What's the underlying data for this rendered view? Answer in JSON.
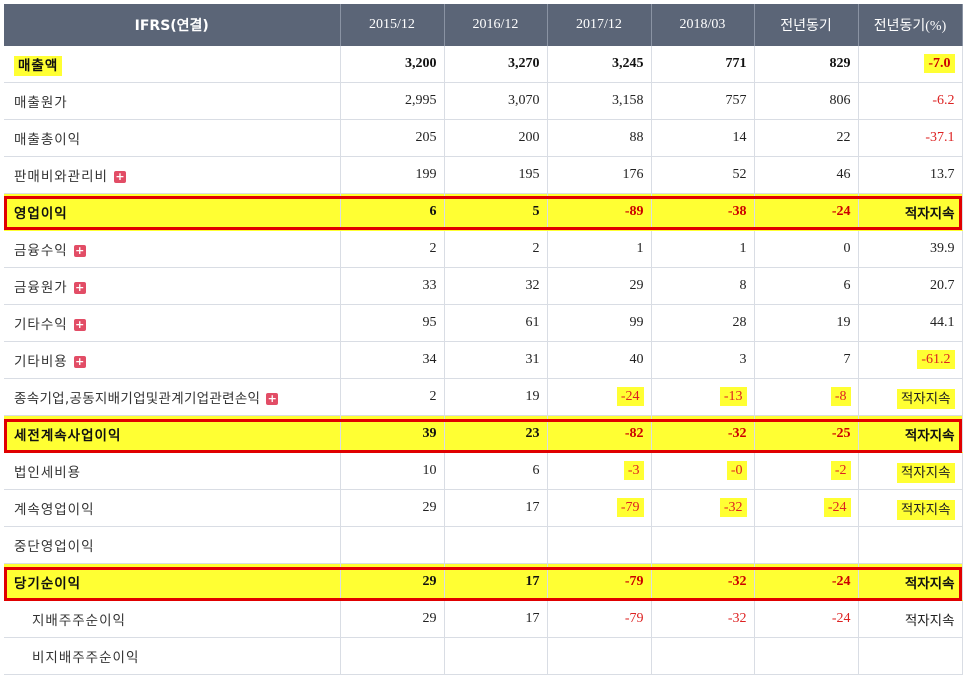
{
  "header": {
    "col0": "IFRS(연결)",
    "cols": [
      "2015/12",
      "2016/12",
      "2017/12",
      "2018/03",
      "전년동기",
      "전년동기(%)"
    ]
  },
  "rows": [
    {
      "label": "매출액",
      "values": [
        "3,200",
        "3,270",
        "3,245",
        "771",
        "829",
        "-7.0"
      ]
    },
    {
      "label": "매출원가",
      "values": [
        "2,995",
        "3,070",
        "3,158",
        "757",
        "806",
        "-6.2"
      ]
    },
    {
      "label": "매출총이익",
      "values": [
        "205",
        "200",
        "88",
        "14",
        "22",
        "-37.1"
      ]
    },
    {
      "label": "판매비와관리비",
      "values": [
        "199",
        "195",
        "176",
        "52",
        "46",
        "13.7"
      ]
    },
    {
      "label": "영업이익",
      "values": [
        "6",
        "5",
        "-89",
        "-38",
        "-24",
        "적자지속"
      ]
    },
    {
      "label": "금융수익",
      "values": [
        "2",
        "2",
        "1",
        "1",
        "0",
        "39.9"
      ]
    },
    {
      "label": "금융원가",
      "values": [
        "33",
        "32",
        "29",
        "8",
        "6",
        "20.7"
      ]
    },
    {
      "label": "기타수익",
      "values": [
        "95",
        "61",
        "99",
        "28",
        "19",
        "44.1"
      ]
    },
    {
      "label": "기타비용",
      "values": [
        "34",
        "31",
        "40",
        "3",
        "7",
        "-61.2"
      ]
    },
    {
      "label": "종속기업,공동지배기업및관계기업관련손익",
      "values": [
        "2",
        "19",
        "-24",
        "-13",
        "-8",
        "적자지속"
      ]
    },
    {
      "label": "세전계속사업이익",
      "values": [
        "39",
        "23",
        "-82",
        "-32",
        "-25",
        "적자지속"
      ]
    },
    {
      "label": "법인세비용",
      "values": [
        "10",
        "6",
        "-3",
        "-0",
        "-2",
        "적자지속"
      ]
    },
    {
      "label": "계속영업이익",
      "values": [
        "29",
        "17",
        "-79",
        "-32",
        "-24",
        "적자지속"
      ]
    },
    {
      "label": "중단영업이익",
      "values": [
        "",
        "",
        "",
        "",
        "",
        ""
      ]
    },
    {
      "label": "당기순이익",
      "values": [
        "29",
        "17",
        "-79",
        "-32",
        "-24",
        "적자지속"
      ]
    },
    {
      "label": "지배주주순이익",
      "values": [
        "29",
        "17",
        "-79",
        "-32",
        "-24",
        "적자지속"
      ]
    },
    {
      "label": "비지배주주순이익",
      "values": [
        "",
        "",
        "",
        "",
        "",
        ""
      ]
    }
  ],
  "expand_icon": "plus-icon",
  "colors": {
    "header_bg": "#5b6577",
    "highlight": "#ffff33",
    "negative": "#dd2222",
    "box_border": "#e00000"
  }
}
